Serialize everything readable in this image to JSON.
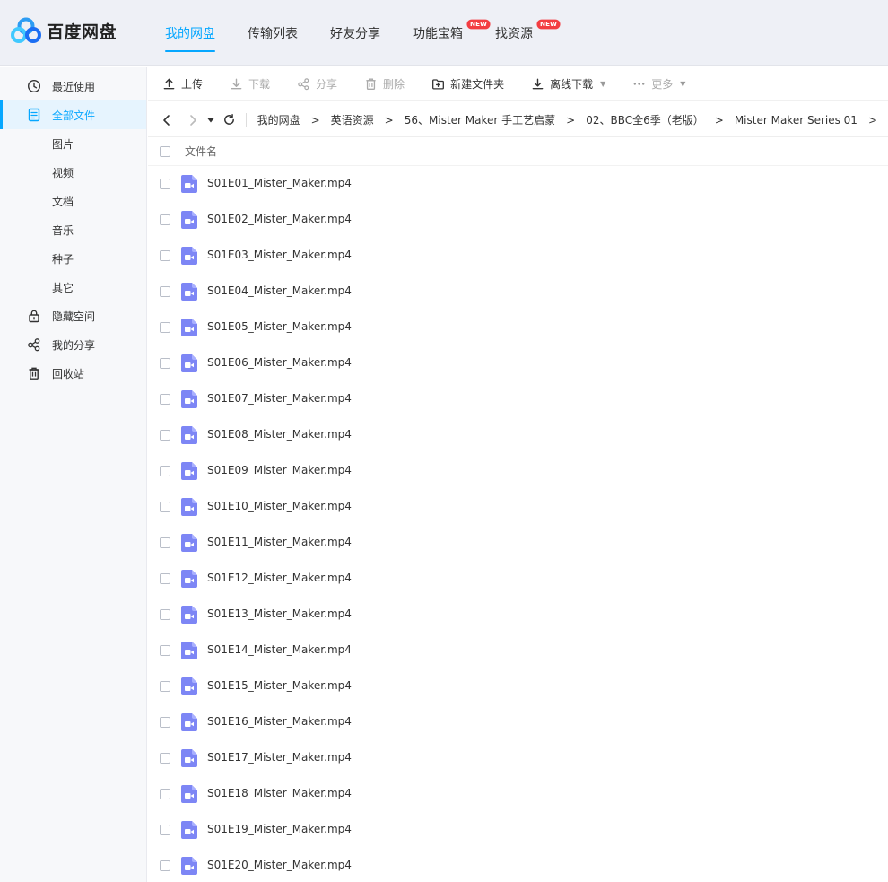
{
  "app": {
    "logo_text": "百度网盘"
  },
  "topnav": [
    {
      "label": "我的网盘",
      "active": true
    },
    {
      "label": "传输列表"
    },
    {
      "label": "好友分享"
    },
    {
      "label": "功能宝箱",
      "badge": "NEW"
    },
    {
      "label": "找资源",
      "badge": "NEW"
    }
  ],
  "sidebar": {
    "items": [
      {
        "label": "最近使用",
        "icon": "clock-icon"
      },
      {
        "label": "全部文件",
        "icon": "file-icon",
        "active": true
      },
      {
        "label": "图片"
      },
      {
        "label": "视频"
      },
      {
        "label": "文档"
      },
      {
        "label": "音乐"
      },
      {
        "label": "种子"
      },
      {
        "label": "其它"
      },
      {
        "label": "隐藏空间",
        "icon": "lock-icon"
      },
      {
        "label": "我的分享",
        "icon": "share-icon"
      },
      {
        "label": "回收站",
        "icon": "trash-icon"
      }
    ]
  },
  "toolbar": {
    "upload": "上传",
    "download": "下载",
    "share": "分享",
    "delete": "删除",
    "new_folder": "新建文件夹",
    "offline_download": "离线下载",
    "more": "更多"
  },
  "breadcrumb": [
    "我的网盘",
    "英语资源",
    "56、Mister Maker 手工艺启蒙",
    "02、BBC全6季（老版）",
    "Mister Maker Series 01"
  ],
  "breadcrumb_sep": ">",
  "list": {
    "header_name": "文件名",
    "files": [
      "S01E01_Mister_Maker.mp4",
      "S01E02_Mister_Maker.mp4",
      "S01E03_Mister_Maker.mp4",
      "S01E04_Mister_Maker.mp4",
      "S01E05_Mister_Maker.mp4",
      "S01E06_Mister_Maker.mp4",
      "S01E07_Mister_Maker.mp4",
      "S01E08_Mister_Maker.mp4",
      "S01E09_Mister_Maker.mp4",
      "S01E10_Mister_Maker.mp4",
      "S01E11_Mister_Maker.mp4",
      "S01E12_Mister_Maker.mp4",
      "S01E13_Mister_Maker.mp4",
      "S01E14_Mister_Maker.mp4",
      "S01E15_Mister_Maker.mp4",
      "S01E16_Mister_Maker.mp4",
      "S01E17_Mister_Maker.mp4",
      "S01E18_Mister_Maker.mp4",
      "S01E19_Mister_Maker.mp4",
      "S01E20_Mister_Maker.mp4"
    ]
  },
  "colors": {
    "accent": "#06a7ff",
    "badge": "#f33d42",
    "video_icon": "#7d86f5"
  }
}
